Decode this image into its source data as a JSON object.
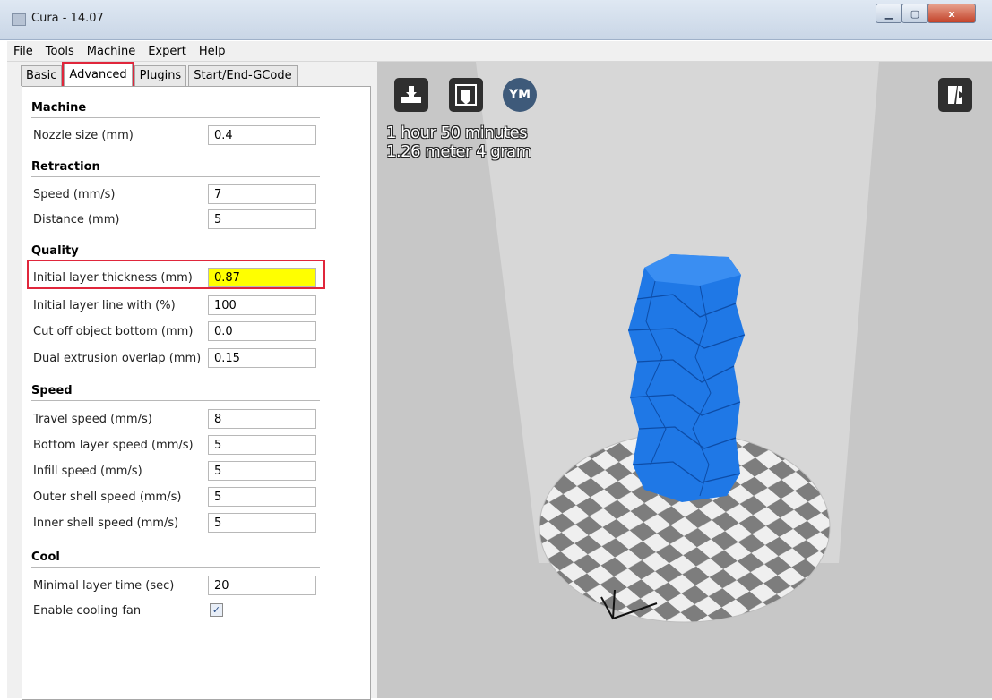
{
  "window": {
    "title": "Cura - 14.07"
  },
  "menu": [
    "File",
    "Tools",
    "Machine",
    "Expert",
    "Help"
  ],
  "tabs": [
    "Basic",
    "Advanced",
    "Plugins",
    "Start/End-GCode"
  ],
  "sections": {
    "machine": "Machine",
    "retraction": "Retraction",
    "quality": "Quality",
    "speed": "Speed",
    "cool": "Cool"
  },
  "fields": {
    "nozzle_size": {
      "label": "Nozzle size (mm)",
      "value": "0.4"
    },
    "retraction_speed": {
      "label": "Speed (mm/s)",
      "value": "7"
    },
    "retraction_distance": {
      "label": "Distance (mm)",
      "value": "5"
    },
    "initial_layer_thickness": {
      "label": "Initial layer thickness (mm)",
      "value": "0.87"
    },
    "initial_layer_line_width": {
      "label": "Initial layer line with (%)",
      "value": "100"
    },
    "cut_off_bottom": {
      "label": "Cut off object bottom (mm)",
      "value": "0.0"
    },
    "dual_extrusion_overlap": {
      "label": "Dual extrusion overlap (mm)",
      "value": "0.15"
    },
    "travel_speed": {
      "label": "Travel speed (mm/s)",
      "value": "8"
    },
    "bottom_layer_speed": {
      "label": "Bottom layer speed (mm/s)",
      "value": "5"
    },
    "infill_speed": {
      "label": "Infill speed (mm/s)",
      "value": "5"
    },
    "outer_shell_speed": {
      "label": "Outer shell speed (mm/s)",
      "value": "5"
    },
    "inner_shell_speed": {
      "label": "Inner shell speed (mm/s)",
      "value": "5"
    },
    "minimal_layer_time": {
      "label": "Minimal layer time (sec)",
      "value": "20"
    },
    "enable_cooling_fan": {
      "label": "Enable cooling fan",
      "checked": true
    }
  },
  "viewport": {
    "ym_label": "YM",
    "print_time": "1 hour 50 minutes",
    "material": "1.26 meter 4 gram"
  },
  "colors": {
    "highlight": "#e0263b",
    "field_highlight": "#ffff00",
    "model": "#1f78e6"
  }
}
